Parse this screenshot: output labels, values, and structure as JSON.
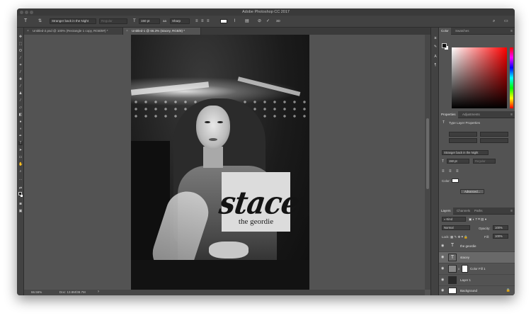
{
  "app": {
    "window_title": "Adobe Photoshop CC 2017"
  },
  "options_bar": {
    "font_family": "Stranger back in the Night",
    "font_style": "Regular",
    "font_size": "150 pt",
    "antialias_icon": "aa",
    "antialias": "Sharp",
    "threed_label": "3D"
  },
  "tabs": [
    {
      "label": "Untitled-2.psd @ 100% (Rectangle 1 copy, RGB/8#) *"
    },
    {
      "label": "Untitled-1 @ 66.3% (stacey, RGB/8) *"
    }
  ],
  "canvas_text": {
    "title": "stacey",
    "subtitle": "the geordie"
  },
  "status_bar": {
    "zoom": "66.56%",
    "doc": "Doc: 13.8M/38.7M"
  },
  "color_panel": {
    "tabs": [
      "Color",
      "Swatches"
    ]
  },
  "properties_panel": {
    "tabs": [
      "Properties",
      "Adjustments"
    ],
    "section_title": "Type Layer Properties",
    "font_family": "Stranger back in the Night",
    "font_size": "150 pt",
    "font_style": "Regular",
    "color_label": "Color:",
    "advanced_button": "Advanced..."
  },
  "layers_panel": {
    "tabs": [
      "Layers",
      "Channels",
      "Paths"
    ],
    "filter_kind": "Kind",
    "blend_mode": "Normal",
    "opacity_label": "Opacity:",
    "opacity_value": "100%",
    "lock_label": "Lock:",
    "fill_label": "Fill:",
    "fill_value": "100%",
    "layers": [
      {
        "name": "the geordie",
        "type": "text",
        "selected": false
      },
      {
        "name": "stacey",
        "type": "text",
        "selected": true
      },
      {
        "name": "Color Fill 1",
        "type": "fill",
        "selected": false
      },
      {
        "name": "Layer 1",
        "type": "image",
        "selected": false
      },
      {
        "name": "Background",
        "type": "image",
        "selected": false
      }
    ]
  },
  "colors": {
    "chrome_dark": "#424242",
    "canvas_bg": "#535353",
    "selected_layer": "#696969"
  }
}
